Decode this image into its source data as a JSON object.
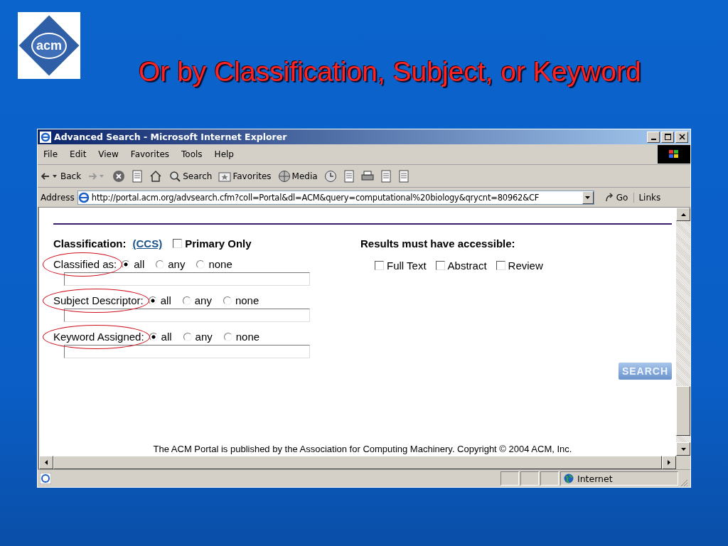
{
  "slide": {
    "logo_text": "acm",
    "title": "Or by Classification, Subject, or Keyword"
  },
  "window": {
    "title": "Advanced Search - Microsoft Internet Explorer"
  },
  "menu": [
    "File",
    "Edit",
    "View",
    "Favorites",
    "Tools",
    "Help"
  ],
  "toolbar": [
    {
      "kind": "back",
      "label": "Back"
    },
    {
      "kind": "forward"
    },
    {
      "kind": "stop"
    },
    {
      "kind": "refresh"
    },
    {
      "kind": "home"
    },
    {
      "kind": "search",
      "label": "Search"
    },
    {
      "kind": "favorites",
      "label": "Favorites"
    },
    {
      "kind": "media",
      "label": "Media"
    },
    {
      "kind": "history"
    },
    {
      "kind": "mail"
    },
    {
      "kind": "print"
    },
    {
      "kind": "edit"
    },
    {
      "kind": "discuss"
    }
  ],
  "address": {
    "label": "Address",
    "value": "http://portal.acm.org/advsearch.cfm?coll=Portal&dl=ACM&query=computational%20biology&qrycnt=80962&CF",
    "go": "Go",
    "links": "Links"
  },
  "form": {
    "classification_label": "Classification:",
    "ccs_link": "(CCS)",
    "primary_only": {
      "label": "Primary Only",
      "checked": false
    },
    "fields": [
      {
        "label": "Classified as:",
        "highlighted": true,
        "options": [
          {
            "label": "all",
            "selected": true
          },
          {
            "label": "any",
            "selected": false
          },
          {
            "label": "none",
            "selected": false
          }
        ]
      },
      {
        "label": "Subject Descriptor:",
        "highlighted": true,
        "options": [
          {
            "label": "all",
            "selected": true
          },
          {
            "label": "any",
            "selected": false
          },
          {
            "label": "none",
            "selected": false
          }
        ]
      },
      {
        "label": "Keyword Assigned:",
        "highlighted": true,
        "options": [
          {
            "label": "all",
            "selected": true
          },
          {
            "label": "any",
            "selected": false
          },
          {
            "label": "none",
            "selected": false
          }
        ]
      }
    ],
    "results": {
      "heading": "Results must have accessible:",
      "options": [
        {
          "label": "Full Text",
          "checked": false
        },
        {
          "label": "Abstract",
          "checked": false
        },
        {
          "label": "Review",
          "checked": false
        }
      ]
    },
    "search_button": "SEARCH",
    "footer": "The ACM Portal is published by the Association for Computing Machinery. Copyright © 2004 ACM, Inc."
  },
  "status_bar": {
    "zone": "Internet"
  }
}
